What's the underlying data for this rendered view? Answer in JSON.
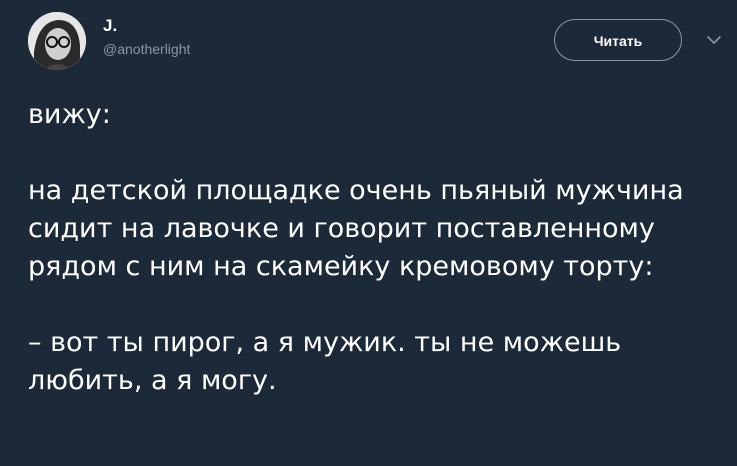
{
  "author": {
    "display_name": "J.",
    "handle": "@anotherlight",
    "avatar_icon": "profile-photo-icon"
  },
  "follow_button": {
    "label": "Читать"
  },
  "menu": {
    "icon": "chevron-down-icon"
  },
  "tweet": {
    "line_1": "вижу:",
    "paragraph_2": "на детской площадке очень пьяный мужчина сидит на лавочке и говорит поставленному рядом с ним на скамейку кремовому торту:",
    "paragraph_3": "– вот ты пирог, а я мужик. ты не можешь любить, а я могу."
  },
  "colors": {
    "background": "#1c2938",
    "text": "#ffffff",
    "secondary_text": "#8899a6",
    "button_border": "#8899a6"
  }
}
